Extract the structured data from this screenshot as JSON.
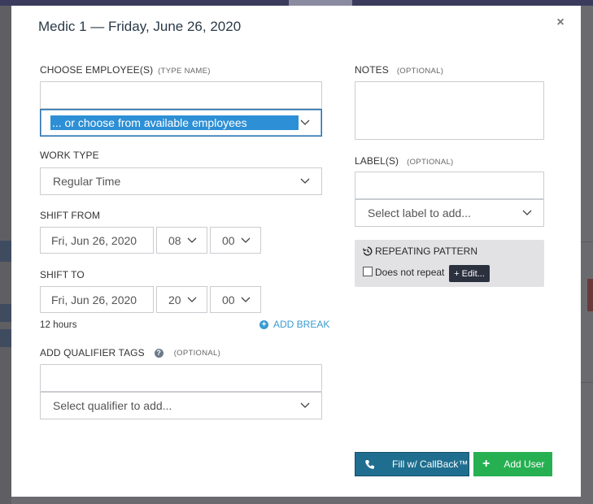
{
  "modal": {
    "title": "Medic 1 — Friday, June 26, 2020",
    "close_glyph": "×"
  },
  "employees": {
    "label": "CHOOSE EMPLOYEE(S)",
    "hint": "(TYPE NAME)",
    "input_value": "",
    "dropdown_value": "... or choose from available employees"
  },
  "work_type": {
    "label": "WORK TYPE",
    "value": "Regular Time"
  },
  "shift_from": {
    "label": "SHIFT FROM",
    "date": "Fri, Jun 26, 2020",
    "hour": "08",
    "minute": "00"
  },
  "shift_to": {
    "label": "SHIFT TO",
    "date": "Fri, Jun 26, 2020",
    "hour": "20",
    "minute": "00"
  },
  "duration": "12 hours",
  "add_break": "ADD BREAK",
  "qualifiers": {
    "label": "ADD QUALIFIER TAGS",
    "hint": "(OPTIONAL)",
    "input_value": "",
    "dropdown_placeholder": "Select qualifier to add..."
  },
  "notes": {
    "label": "NOTES",
    "hint": "(OPTIONAL)",
    "value": ""
  },
  "labels": {
    "label": "LABEL(S)",
    "hint": "(OPTIONAL)",
    "input_value": "",
    "dropdown_placeholder": "Select label to add..."
  },
  "repeating": {
    "title": "REPEATING PATTERN",
    "checkbox_label": "Does not repeat",
    "checked": false,
    "edit_label": "+ Edit..."
  },
  "actions": {
    "callback_label": "Fill w/ CallBack™",
    "add_user_label": "Add User"
  },
  "colors": {
    "accent_blue": "#2d8fd5",
    "callback_button": "#1f6e8f",
    "add_user_button": "#26b052",
    "link_blue": "#3a9bd0"
  },
  "icons": {
    "close": "close-icon",
    "chevron": "chevron-down-icon",
    "help": "question-circle-icon",
    "add_break": "plus-circle-icon",
    "repeat": "history-icon",
    "phone": "phone-icon",
    "plus": "plus-icon"
  }
}
